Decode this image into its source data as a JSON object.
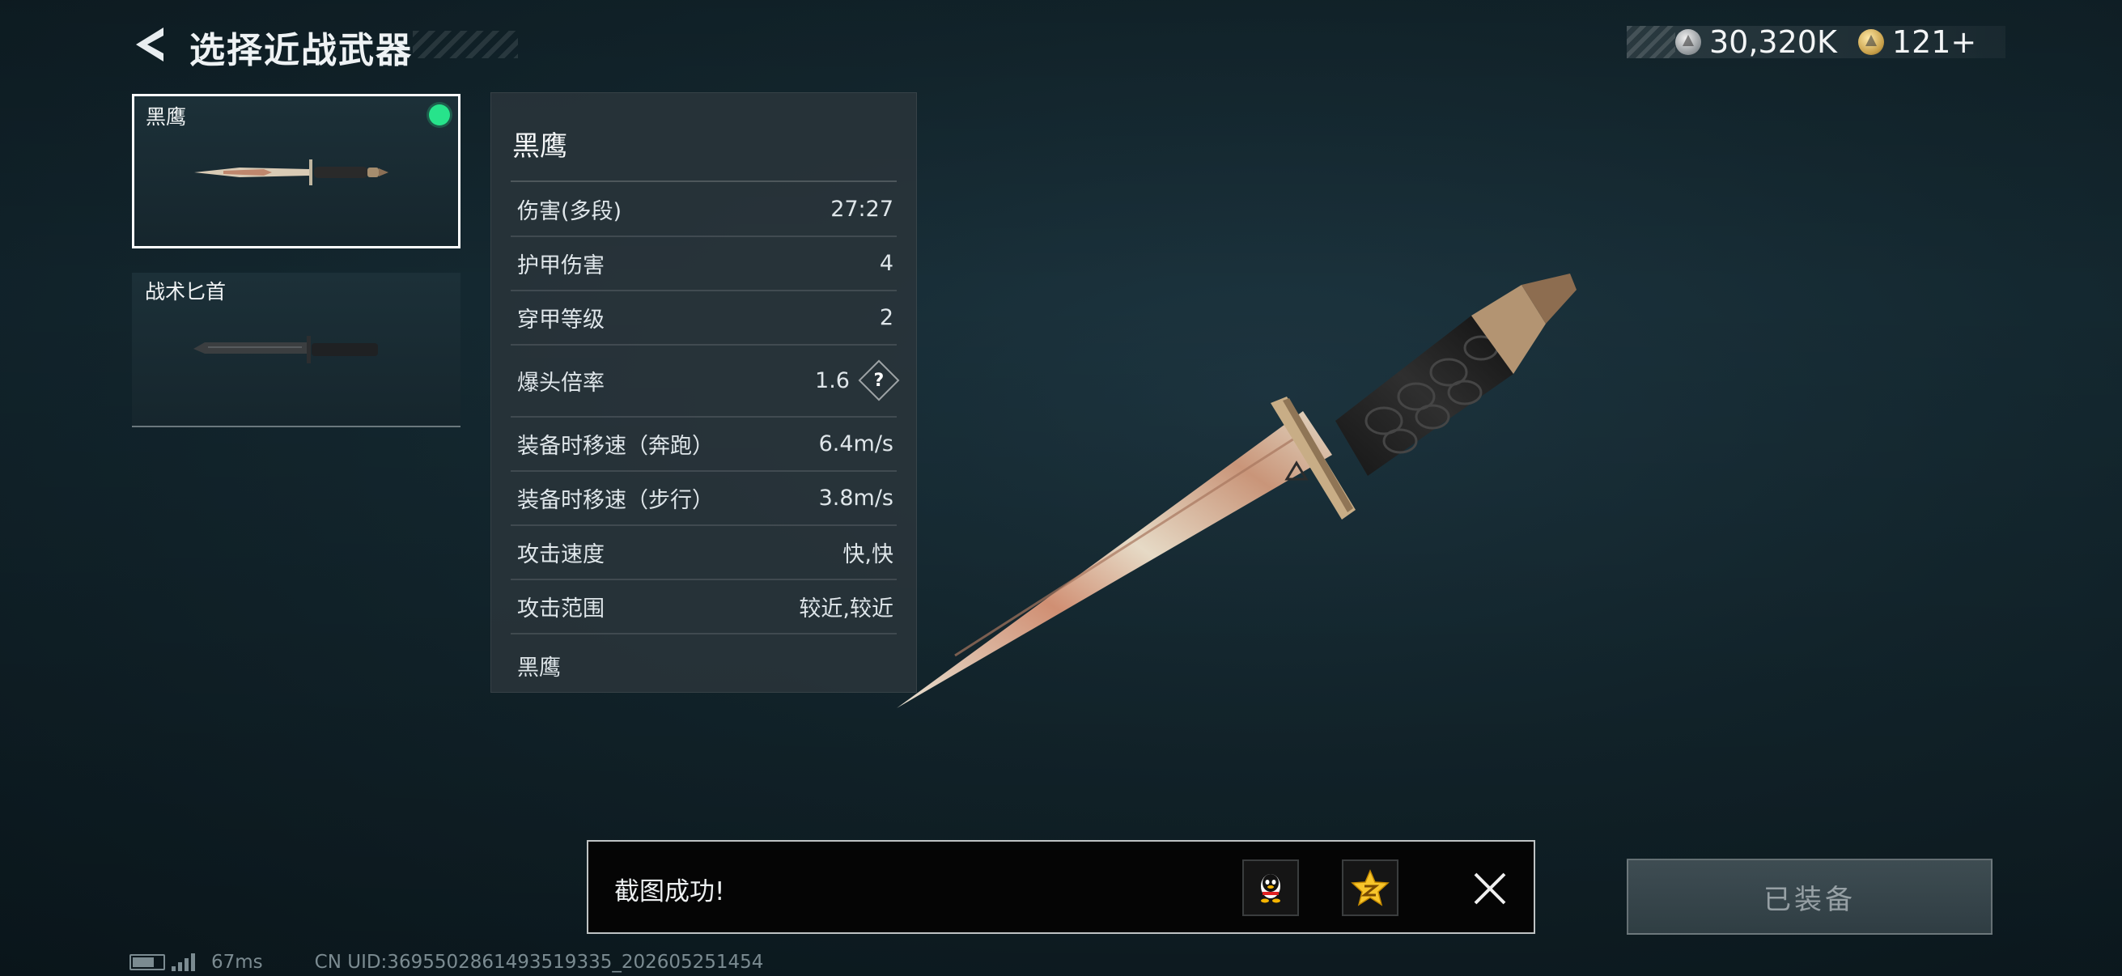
{
  "header": {
    "title": "选择近战武器",
    "currency": [
      {
        "icon": "silver-coin-icon",
        "value": "30,320K"
      },
      {
        "icon": "gold-coin-icon",
        "value": "121+"
      }
    ]
  },
  "weapons": [
    {
      "name": "黑鹰",
      "selected": true,
      "equipped": true
    },
    {
      "name": "战术匕首",
      "selected": false,
      "equipped": false
    }
  ],
  "stats": {
    "title": "黑鹰",
    "rows": [
      {
        "label": "伤害(多段)",
        "value": "27:27"
      },
      {
        "label": "护甲伤害",
        "value": "4"
      },
      {
        "label": "穿甲等级",
        "value": "2"
      },
      {
        "label": "爆头倍率",
        "value": "1.6",
        "help": "?"
      },
      {
        "label": "装备时移速（奔跑）",
        "value": "6.4m/s"
      },
      {
        "label": "装备时移速（步行）",
        "value": "3.8m/s"
      },
      {
        "label": "攻击速度",
        "value": "快,快"
      },
      {
        "label": "攻击范围",
        "value": "较近,较近"
      }
    ],
    "footer": "黑鹰"
  },
  "toast": {
    "message": "截图成功!",
    "buttons": [
      "qq-share-icon",
      "qzone-share-icon",
      "close-icon"
    ]
  },
  "equip_button": "已装备",
  "status": {
    "ping": "67ms",
    "uid": "CN UID:3695502861493519335_202605251454"
  },
  "colors": {
    "equipped_dot": "#27e38b",
    "background": "#142830"
  }
}
